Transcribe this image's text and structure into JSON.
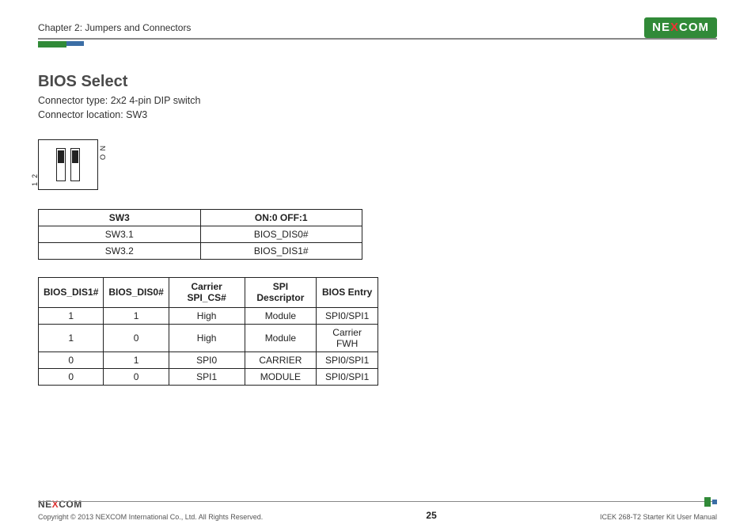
{
  "header": {
    "chapter": "Chapter 2: Jumpers and Connectors",
    "brand_pre": "NE",
    "brand_x": "X",
    "brand_post": "COM"
  },
  "section": {
    "title": "BIOS Select",
    "connector_type_line": "Connector type: 2x2 4-pin DIP switch",
    "connector_location_line": "Connector location: SW3"
  },
  "dip": {
    "on_label": "O N",
    "pin1": "1",
    "pin2": "2"
  },
  "table1": {
    "headers": [
      "SW3",
      "ON:0 OFF:1"
    ],
    "rows": [
      [
        "SW3.1",
        "BIOS_DIS0#"
      ],
      [
        "SW3.2",
        "BIOS_DIS1#"
      ]
    ]
  },
  "table2": {
    "headers": [
      "BIOS_DIS1#",
      "BIOS_DIS0#",
      "Carrier SPI_CS#",
      "SPI Descriptor",
      "BIOS Entry"
    ],
    "rows": [
      [
        "1",
        "1",
        "High",
        "Module",
        "SPI0/SPI1"
      ],
      [
        "1",
        "0",
        "High",
        "Module",
        "Carrier FWH"
      ],
      [
        "0",
        "1",
        "SPI0",
        "CARRIER",
        "SPI0/SPI1"
      ],
      [
        "0",
        "0",
        "SPI1",
        "MODULE",
        "SPI0/SPI1"
      ]
    ]
  },
  "footer": {
    "brand_pre": "NE",
    "brand_x": "X",
    "brand_post": "COM",
    "copyright": "Copyright © 2013 NEXCOM International Co., Ltd. All Rights Reserved.",
    "page_number": "25",
    "manual": "ICEK 268-T2 Starter Kit User Manual"
  }
}
